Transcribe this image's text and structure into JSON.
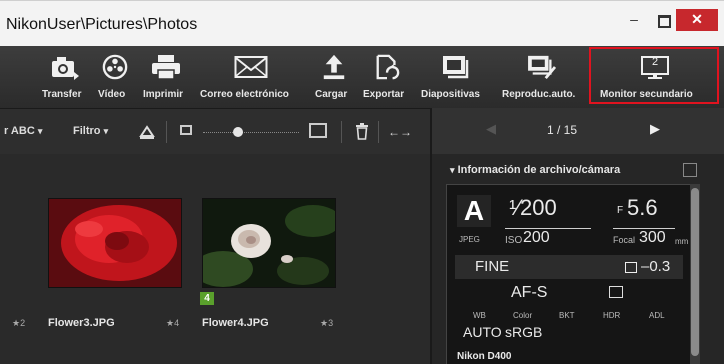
{
  "window": {
    "title": "NikonUser\\Pictures\\Photos",
    "minimize": "–",
    "close": "✕"
  },
  "toolbar": {
    "items": [
      {
        "label": "Transfer",
        "icon": "camera-transfer-icon"
      },
      {
        "label": "Vídeo",
        "icon": "film-reel-icon"
      },
      {
        "label": "Imprimir",
        "icon": "printer-icon"
      },
      {
        "label": "Correo electrónico",
        "icon": "envelope-icon"
      },
      {
        "label": "Cargar",
        "icon": "upload-icon"
      },
      {
        "label": "Exportar",
        "icon": "export-icon"
      },
      {
        "label": "Diapositivas",
        "icon": "slideshow-icon"
      },
      {
        "label": "Reproduc.auto.",
        "icon": "auto-play-icon"
      },
      {
        "label": "Monitor secundario",
        "icon": "secondary-monitor-icon",
        "icon_number": "2"
      }
    ],
    "highlight_color": "#e0131f"
  },
  "subbar": {
    "sort_label": "r ABC",
    "filter_label": "Filtro",
    "dropdown_glyph": "▾",
    "swap_glyph": "←→"
  },
  "thumbnails": [
    {
      "name": "Flower3.JPG",
      "left_star": "★2",
      "right_star": "★4"
    },
    {
      "name": "Flower4.JPG",
      "right_star": "★3",
      "badge": "4"
    }
  ],
  "pager": {
    "text": "1 / 15",
    "prev": "◀",
    "next": "▶"
  },
  "info": {
    "header": "Información de archivo/cámara",
    "collapse_glyph": "▾",
    "mode": "A",
    "shutter": "¹⁄200",
    "aperture_prefix": "F",
    "aperture": "5.6",
    "format": "JPEG",
    "iso_label": "ISO",
    "iso": "200",
    "focal_label": "Focal",
    "focal": "300",
    "focal_unit": "mm",
    "quality": "FINE",
    "exposure_comp": "–0.3",
    "focus_mode": "AF-S",
    "labels_row": [
      "WB",
      "Color",
      "BKT",
      "HDR",
      "ADL"
    ],
    "wb": "AUTO",
    "color_space": "sRGB",
    "camera": "Nikon D400"
  }
}
